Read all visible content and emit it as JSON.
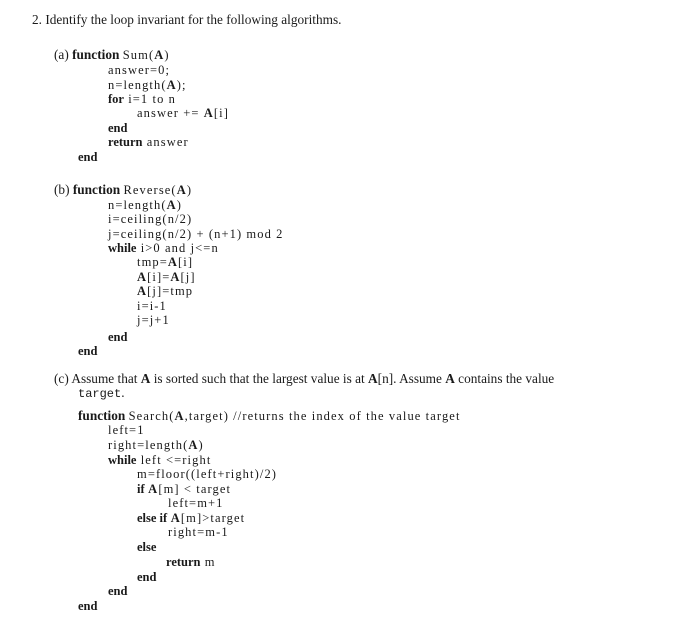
{
  "question": {
    "number": "2.",
    "text": "Identify the loop invariant for the following algorithms."
  },
  "parts": {
    "a": {
      "label": "(a)",
      "header": {
        "kw": "function",
        "name": "Sum(",
        "arg": "A",
        "close": ")"
      },
      "lines": {
        "l1": "answer=0;",
        "l2_pre": "n=length(",
        "l2_arg": "A",
        "l2_post": ");",
        "l3_kw": "for",
        "l3_rest": " i=1 to n",
        "l4_pre": "answer += ",
        "l4_arr": "A",
        "l4_post": "[i]",
        "l5_kw": "end",
        "l6_kw": "return",
        "l6_rest": " answer",
        "l7_kw": "end"
      }
    },
    "b": {
      "label": "(b)",
      "header": {
        "kw": "function",
        "name": "Reverse(",
        "arg": "A",
        "close": ")"
      },
      "lines": {
        "l1_pre": "n=length(",
        "l1_arg": "A",
        "l1_post": ")",
        "l2": "i=ceiling(n/2)",
        "l3": "j=ceiling(n/2) + (n+1) mod 2",
        "l4_kw": "while",
        "l4_rest": " i>0 and j<=n",
        "l5_pre": "tmp=",
        "l5_arr": "A",
        "l5_post": "[i]",
        "l6_a": "A",
        "l6_b": "[i]=",
        "l6_c": "A",
        "l6_d": "[j]",
        "l7_a": "A",
        "l7_b": "[j]=tmp",
        "l8": "i=i-1",
        "l9": "j=j+1",
        "l10_kw": "end",
        "l11_kw": "end"
      }
    },
    "c": {
      "label": "(c)",
      "desc": {
        "p1": "Assume that ",
        "a1": "A",
        "p2": " is sorted such that the largest value is at ",
        "a2": "A",
        "p3": "[n]. Assume ",
        "a3": "A",
        "p4": " contains the value",
        "tt": "target",
        "p5": "."
      },
      "header": {
        "kw": "function",
        "name": "Search(",
        "arg": "A",
        "rest": ",target) //returns the index of the value target"
      },
      "lines": {
        "l1": "left=1",
        "l2_pre": "right=length(",
        "l2_arg": "A",
        "l2_post": ")",
        "l3_kw": "while",
        "l3_rest": " left <=right",
        "l4": "m=floor((left+right)/2)",
        "l5_kw": "if",
        "l5_arr": " A",
        "l5_rest": "[m] < target",
        "l6": "left=m+1",
        "l7_kw": "else if",
        "l7_arr": " A",
        "l7_rest": "[m]>target",
        "l8": "right=m-1",
        "l9_kw": "else",
        "l10_kw": "return",
        "l10_rest": " m",
        "l11_kw": "end",
        "l12_kw": "end",
        "l13_kw": "end"
      }
    }
  }
}
